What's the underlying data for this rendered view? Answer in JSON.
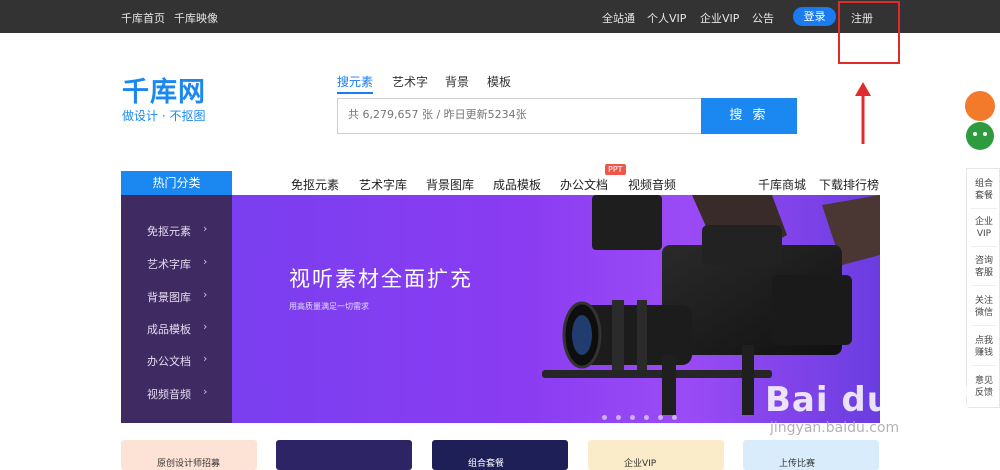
{
  "topbar": {
    "left_links": [
      "千库首页",
      "千库映像"
    ],
    "right_links": [
      "全站通",
      "个人VIP",
      "企业VIP",
      "公告"
    ],
    "login": "登录",
    "register": "注册"
  },
  "logo": {
    "name": "千库网",
    "slogan": "做设计 · 不抠图"
  },
  "search": {
    "tabs": [
      "搜元素",
      "艺术字",
      "背景",
      "模板"
    ],
    "active_tab": "搜元素",
    "placeholder": "共 6,279,657 张 / 昨日更新5234张",
    "button": "搜 索"
  },
  "nav": {
    "hot_category": "热门分类",
    "items": [
      "免抠元素",
      "艺术字库",
      "背景图库",
      "成品模板",
      "办公文档",
      "视频音频"
    ],
    "badge": "PPT",
    "right_items": [
      "千库商城",
      "下载排行榜"
    ]
  },
  "sidebar": {
    "items": [
      "免抠元素",
      "艺术字库",
      "背景图库",
      "成品模板",
      "办公文档",
      "视频音频"
    ],
    "arrow": "›"
  },
  "banner": {
    "title": "视听素材全面扩充",
    "subtitle": "用高质量满足一切需求"
  },
  "cards": [
    {
      "label": "原创设计师招募",
      "color": "#fde3d6"
    },
    {
      "label": "",
      "color": "#2d2466"
    },
    {
      "label": "组合套餐",
      "color": "#1f1f57"
    },
    {
      "label": "企业VIP",
      "color": "#fbecc9"
    },
    {
      "label": "上传比赛",
      "color": "#d8ecfb"
    }
  ],
  "right_panel": {
    "items": [
      "组合\n套餐",
      "企业\nVIP",
      "咨询\n客服",
      "关注\n微信",
      "点我\n赚钱",
      "意见\n反馈"
    ]
  },
  "watermark": {
    "logo": "Bai du 经验",
    "url": "jingyan.baidu.com"
  },
  "colors": {
    "accent": "#1a88f0",
    "topbar": "#333333",
    "sidebar": "#3f2a62",
    "banner": "#8a3cf2",
    "annotation": "#e02b2b"
  }
}
